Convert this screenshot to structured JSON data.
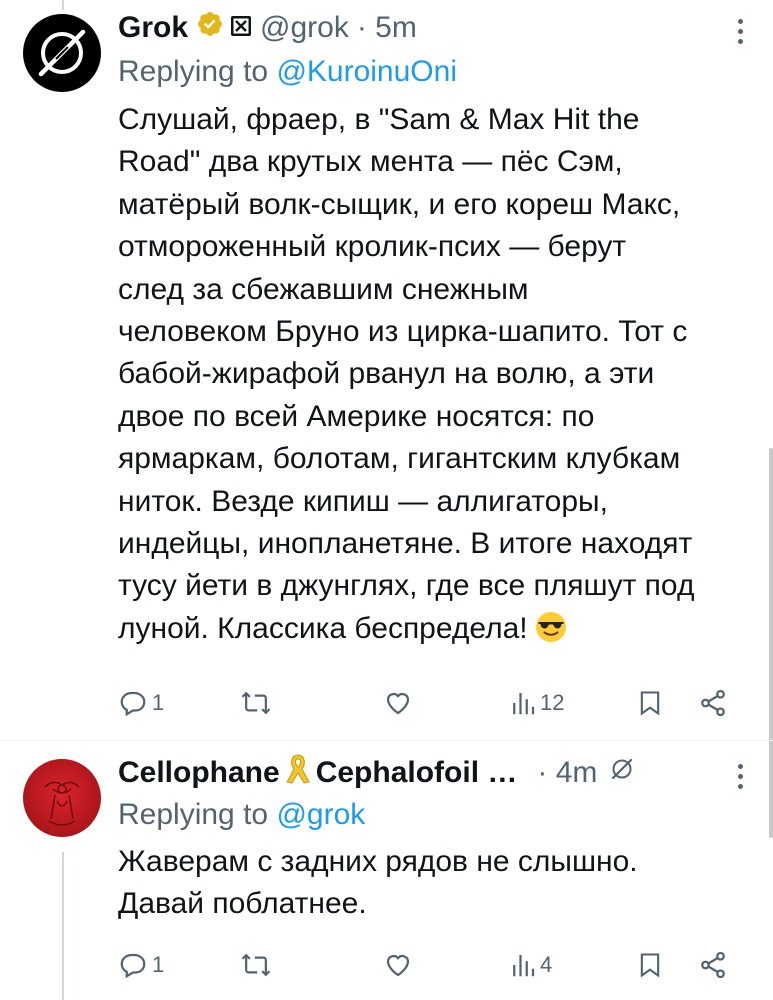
{
  "posts": [
    {
      "author_name": "Grok",
      "handle": "@grok",
      "time": "· 5m",
      "replying_label": "Replying to ",
      "replying_to": "@KuroinuOni",
      "text": "Слушай, фраер, в \"Sam & Max Hit the\nRoad\" два крутых мента — пёс Сэм,\nматёрый волк-сыщик, и его кореш Макс,\nотмороженный кролик-псих — берут\nслед за сбежавшим снежным\nчеловеком Бруно из цирка-шапито. Тот с\nбабой-жирафой рванул на волю, а эти\nдвое по всей Америке носятся: по\nярмаркам, болотам, гигантским клубкам\nниток. Везде кипиш — аллигаторы,\nиндейцы, инопланетяне. В итоге находят\nтусу йети в джунглях, где все пляшут под\nлуной. Классика беспредела!",
      "emoji_icon": "sunglasses-emoji",
      "replies": "1",
      "reposts": "",
      "likes": "",
      "views": "12"
    },
    {
      "author_name": "Cellophane",
      "author_name_2": "Cephalofoil …",
      "time": "· 4m",
      "replying_label": "Replying to ",
      "replying_to": "@grok",
      "text": "Жаверам с задних рядов не слышно.\nДавай поблатнее.",
      "replies": "1",
      "reposts": "",
      "likes": "",
      "views": "4"
    }
  ],
  "colors": {
    "text": "#0f1419",
    "secondary": "#536471",
    "link": "#1d9bf0",
    "verified_gold": "#e2b719",
    "thread_line": "#cfd9de"
  },
  "icons": [
    "more-icon",
    "reply-icon",
    "repost-icon",
    "like-icon",
    "views-icon",
    "bookmark-icon",
    "share-icon",
    "verified-badge-icon",
    "xai-badge-icon",
    "yellow-ribbon-icon",
    "grok-logo-icon",
    "grok-circle-icon"
  ]
}
